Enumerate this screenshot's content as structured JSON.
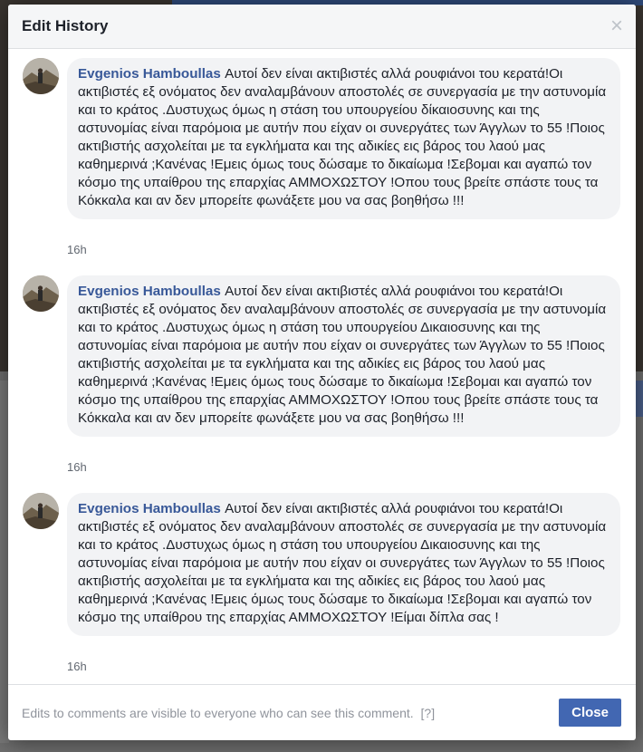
{
  "dialog": {
    "title": "Edit History",
    "close_symbol": "×"
  },
  "entries": [
    {
      "author": "Evgenios Hamboullas",
      "text": "Αυτοί δεν είναι ακτιβιστές αλλά ρουφιάνοι του κερατά!Οι ακτιβιστές εξ ονόματος δεν αναλαμβάνουν αποστολές σε συνεργασία με την αστυνομία και το κράτος .Δυστυχως όμως η στάση του υπουργείου δίκαιοσυνης και της αστυνομίας είναι παρόμοια με αυτήν που είχαν οι συνεργάτες των Άγγλων το 55 !Ποιος ακτιβιστής ασχολείται με τα εγκλήματα και της αδικίες εις βάρος του λαού μας καθημερινά ;Κανένας !Εμεις όμως τους δώσαμε το δικαίωμα !Σεβομαι και αγαπώ τον κόσμο της υπαίθρου της επαρχίας ΑΜΜΟΧΩΣΤΟΥ !Οπου τους βρείτε σπάστε τους τα Κόκκαλα και αν δεν μπορείτε φωνάξετε μου να σας βοηθήσω !!!",
      "time": "16h"
    },
    {
      "author": "Evgenios Hamboullas",
      "text": "Αυτοί δεν είναι ακτιβιστές αλλά ρουφιάνοι του κερατά!Οι ακτιβιστές εξ ονόματος δεν αναλαμβάνουν αποστολές σε συνεργασία με την αστυνομία και το κράτος .Δυστυχως όμως η στάση του υπουργείου Δικαιοσυνης και της αστυνομίας είναι παρόμοια με αυτήν που είχαν οι συνεργάτες των Άγγλων το 55 !Ποιος ακτιβιστής ασχολείται με τα εγκλήματα και της αδικίες εις βάρος του λαού μας καθημερινά ;Κανένας !Εμεις όμως τους δώσαμε το δικαίωμα !Σεβομαι και αγαπώ τον κόσμο της υπαίθρου της επαρχίας ΑΜΜΟΧΩΣΤΟΥ !Οπου τους βρείτε σπάστε τους τα Κόκκαλα και αν δεν μπορείτε φωνάξετε μου να σας βοηθήσω !!!",
      "time": "16h"
    },
    {
      "author": "Evgenios Hamboullas",
      "text": "Αυτοί δεν είναι ακτιβιστές αλλά ρουφιάνοι του κερατά!Οι ακτιβιστές εξ ονόματος δεν αναλαμβάνουν αποστολές σε συνεργασία με την αστυνομία και το κράτος .Δυστυχως όμως η στάση του υπουργείου Δικαιοσυνης και της αστυνομίας είναι παρόμοια με αυτήν που είχαν οι συνεργάτες των Άγγλων το 55 !Ποιος ακτιβιστής ασχολείται με τα εγκλήματα και της αδικίες εις βάρος του λαού μας καθημερινά ;Κανένας !Εμεις όμως τους δώσαμε το δικαίωμα !Σεβομαι και αγαπώ τον κόσμο της υπαίθρου της επαρχίας ΑΜΜΟΧΩΣΤΟΥ !Είμαι δίπλα σας !",
      "time": "16h"
    }
  ],
  "footer": {
    "note": "Edits to comments are visible to everyone who can see this comment.",
    "help": "[?]",
    "close_label": "Close"
  },
  "colors": {
    "accent": "#4267b2",
    "author_link": "#385898",
    "bubble_bg": "#f2f3f5"
  }
}
